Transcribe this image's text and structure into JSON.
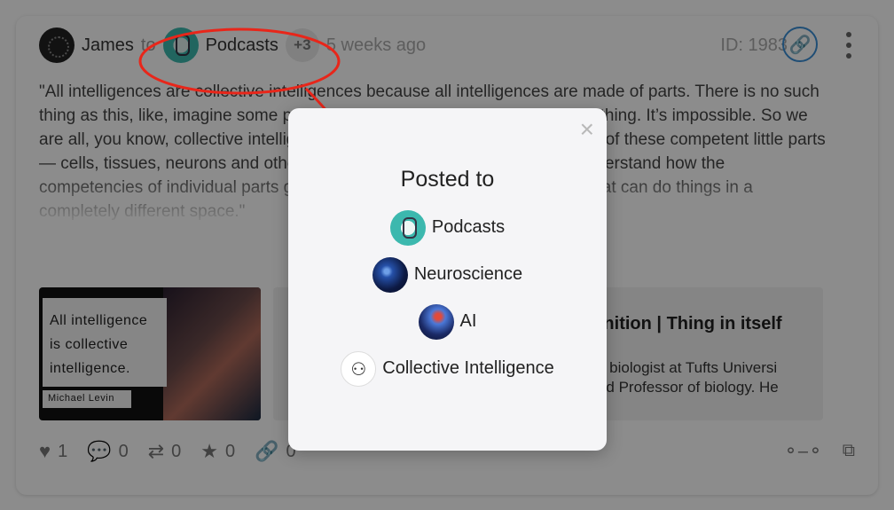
{
  "post": {
    "user_name": "James",
    "to_word": "to",
    "space_name": "Podcasts",
    "more_count": "+3",
    "time_ago": "5 weeks ago",
    "id_label": "ID: 1983",
    "text": "\"All intelligences are collective intelligences because all intelligences are made of parts. There is no such thing as this, like, imagine some pure intelligence that is a single indivisible thing. It’s impossible. So we are all, you know, collective intelligences basically… right? We are all made of these competent little parts — cells, tissues, neurons and other things, and the big puzzle here is to understand how the competencies of individual parts give rise to a whole, at the next level up, that can do things in a completely different space.\"",
    "preview": {
      "quote_line1": "All intelligence",
      "quote_line2": "is collective",
      "quote_line3": "intelligence.",
      "author": "Michael Levin",
      "title": "ognition | Thing in itself",
      "desc_line1": "etic biologist at Tufts Universi",
      "desc_line2": "shed Professor of biology. He"
    },
    "stats": {
      "likes": "1",
      "comments": "0",
      "reposts": "0",
      "stars": "0",
      "links": "0"
    }
  },
  "modal": {
    "title": "Posted to",
    "close_label": "×",
    "spaces": [
      {
        "name": "Podcasts",
        "icon": "podcasts-avatar"
      },
      {
        "name": "Neuroscience",
        "icon": "neuroscience-avatar"
      },
      {
        "name": "AI",
        "icon": "ai-avatar"
      },
      {
        "name": "Collective Intelligence",
        "icon": "collective-intelligence-avatar"
      }
    ]
  },
  "colors": {
    "annotation": "#e8261a",
    "link_accent": "#3b8fd6",
    "overlay": "rgba(0,0,0,0.45)"
  }
}
